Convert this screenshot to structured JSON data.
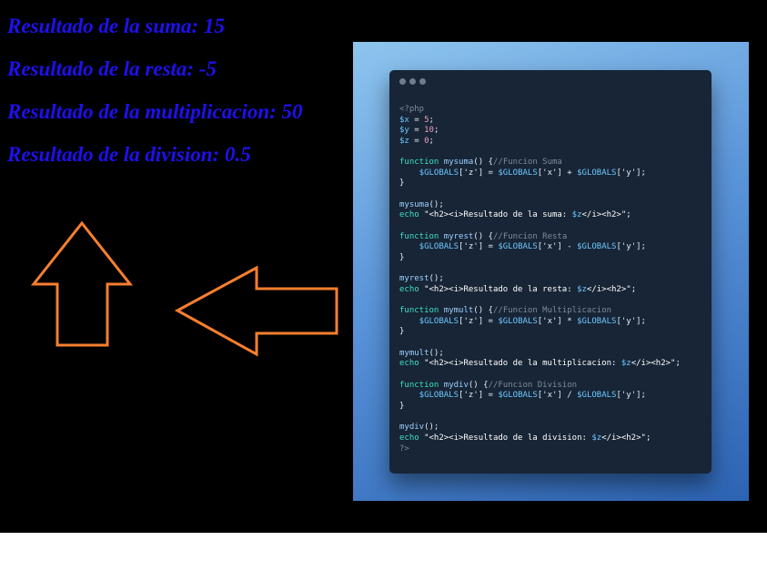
{
  "results": [
    "Resultado de la suma: 15",
    "Resultado de la resta: -5",
    "Resultado de la multiplicacion: 50",
    "Resultado de la division: 0.5"
  ],
  "colors": {
    "result_text": "#1f10ee",
    "arrow_stroke": "#f77f2f",
    "page_background": "#000000",
    "code_background": "#172536"
  },
  "code_window": {
    "lines": [
      [
        {
          "t": "<?php",
          "c": "tag"
        }
      ],
      [
        {
          "t": "$x",
          "c": "var"
        },
        {
          "t": " = ",
          "c": "pl"
        },
        {
          "t": "5",
          "c": "num"
        },
        {
          "t": ";",
          "c": "pl"
        }
      ],
      [
        {
          "t": "$y",
          "c": "var"
        },
        {
          "t": " = ",
          "c": "pl"
        },
        {
          "t": "10",
          "c": "num"
        },
        {
          "t": ";",
          "c": "pl"
        }
      ],
      [
        {
          "t": "$z",
          "c": "var"
        },
        {
          "t": " = ",
          "c": "pl"
        },
        {
          "t": "0",
          "c": "num"
        },
        {
          "t": ";",
          "c": "pl"
        }
      ],
      [],
      [
        {
          "t": "function ",
          "c": "kw"
        },
        {
          "t": "mysuma",
          "c": "fn"
        },
        {
          "t": "() {",
          "c": "pl"
        },
        {
          "t": "//Funcion Suma",
          "c": "cm"
        }
      ],
      [
        {
          "t": "    $GLOBALS",
          "c": "var"
        },
        {
          "t": "['z'] = ",
          "c": "pl"
        },
        {
          "t": "$GLOBALS",
          "c": "var"
        },
        {
          "t": "['x'] + ",
          "c": "pl"
        },
        {
          "t": "$GLOBALS",
          "c": "var"
        },
        {
          "t": "['y'];",
          "c": "pl"
        }
      ],
      [
        {
          "t": "}",
          "c": "pl"
        }
      ],
      [],
      [
        {
          "t": "mysuma",
          "c": "fn"
        },
        {
          "t": "();",
          "c": "pl"
        }
      ],
      [
        {
          "t": "echo ",
          "c": "kw"
        },
        {
          "t": "\"<h2><i>Resultado de la suma: ",
          "c": "str"
        },
        {
          "t": "$z",
          "c": "var"
        },
        {
          "t": "</i><h2>\";",
          "c": "str"
        }
      ],
      [],
      [
        {
          "t": "function ",
          "c": "kw"
        },
        {
          "t": "myrest",
          "c": "fn"
        },
        {
          "t": "() {",
          "c": "pl"
        },
        {
          "t": "//Funcion Resta",
          "c": "cm"
        }
      ],
      [
        {
          "t": "    $GLOBALS",
          "c": "var"
        },
        {
          "t": "['z'] = ",
          "c": "pl"
        },
        {
          "t": "$GLOBALS",
          "c": "var"
        },
        {
          "t": "['x'] - ",
          "c": "pl"
        },
        {
          "t": "$GLOBALS",
          "c": "var"
        },
        {
          "t": "['y'];",
          "c": "pl"
        }
      ],
      [
        {
          "t": "}",
          "c": "pl"
        }
      ],
      [],
      [
        {
          "t": "myrest",
          "c": "fn"
        },
        {
          "t": "();",
          "c": "pl"
        }
      ],
      [
        {
          "t": "echo ",
          "c": "kw"
        },
        {
          "t": "\"<h2><i>Resultado de la resta: ",
          "c": "str"
        },
        {
          "t": "$z",
          "c": "var"
        },
        {
          "t": "</i><h2>\";",
          "c": "str"
        }
      ],
      [],
      [
        {
          "t": "function ",
          "c": "kw"
        },
        {
          "t": "mymult",
          "c": "fn"
        },
        {
          "t": "() {",
          "c": "pl"
        },
        {
          "t": "//Funcion Multiplicacion",
          "c": "cm"
        }
      ],
      [
        {
          "t": "    $GLOBALS",
          "c": "var"
        },
        {
          "t": "['z'] = ",
          "c": "pl"
        },
        {
          "t": "$GLOBALS",
          "c": "var"
        },
        {
          "t": "['x'] * ",
          "c": "pl"
        },
        {
          "t": "$GLOBALS",
          "c": "var"
        },
        {
          "t": "['y'];",
          "c": "pl"
        }
      ],
      [
        {
          "t": "}",
          "c": "pl"
        }
      ],
      [],
      [
        {
          "t": "mymult",
          "c": "fn"
        },
        {
          "t": "();",
          "c": "pl"
        }
      ],
      [
        {
          "t": "echo ",
          "c": "kw"
        },
        {
          "t": "\"<h2><i>Resultado de la multiplicacion: ",
          "c": "str"
        },
        {
          "t": "$z",
          "c": "var"
        },
        {
          "t": "</i><h2>\";",
          "c": "str"
        }
      ],
      [],
      [
        {
          "t": "function ",
          "c": "kw"
        },
        {
          "t": "mydiv",
          "c": "fn"
        },
        {
          "t": "() {",
          "c": "pl"
        },
        {
          "t": "//Funcion Division",
          "c": "cm"
        }
      ],
      [
        {
          "t": "    $GLOBALS",
          "c": "var"
        },
        {
          "t": "['z'] = ",
          "c": "pl"
        },
        {
          "t": "$GLOBALS",
          "c": "var"
        },
        {
          "t": "['x'] / ",
          "c": "pl"
        },
        {
          "t": "$GLOBALS",
          "c": "var"
        },
        {
          "t": "['y'];",
          "c": "pl"
        }
      ],
      [
        {
          "t": "}",
          "c": "pl"
        }
      ],
      [],
      [
        {
          "t": "mydiv",
          "c": "fn"
        },
        {
          "t": "();",
          "c": "pl"
        }
      ],
      [
        {
          "t": "echo ",
          "c": "kw"
        },
        {
          "t": "\"<h2><i>Resultado de la division: ",
          "c": "str"
        },
        {
          "t": "$z",
          "c": "var"
        },
        {
          "t": "</i><h2>\";",
          "c": "str"
        }
      ],
      [
        {
          "t": "?>",
          "c": "tag"
        }
      ]
    ]
  }
}
